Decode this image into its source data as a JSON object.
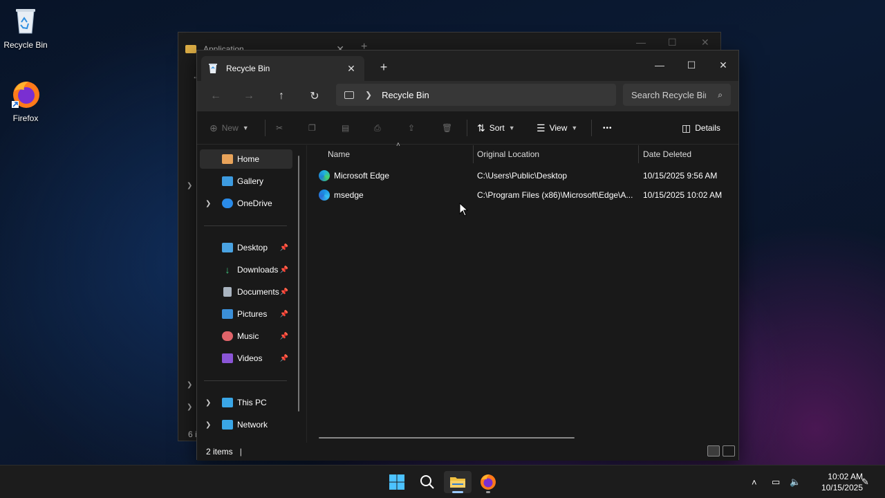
{
  "desktop": {
    "icons": [
      {
        "label": "Recycle Bin"
      },
      {
        "label": "Firefox"
      }
    ]
  },
  "background_window": {
    "tab_title": "Application",
    "status_text": "6 i"
  },
  "window": {
    "tab_title": "Recycle Bin",
    "address": {
      "crumb": "Recycle Bin",
      "search_placeholder": "Search Recycle Bin"
    },
    "toolbar": {
      "new_label": "New",
      "sort_label": "Sort",
      "view_label": "View",
      "more_label": "•••",
      "details_label": "Details"
    },
    "nav": {
      "top": [
        {
          "label": "Home"
        },
        {
          "label": "Gallery"
        },
        {
          "label": "OneDrive"
        }
      ],
      "quick": [
        {
          "label": "Desktop"
        },
        {
          "label": "Downloads"
        },
        {
          "label": "Documents"
        },
        {
          "label": "Pictures"
        },
        {
          "label": "Music"
        },
        {
          "label": "Videos"
        }
      ],
      "bottom": [
        {
          "label": "This PC"
        },
        {
          "label": "Network"
        }
      ]
    },
    "columns": {
      "name": "Name",
      "location": "Original Location",
      "date": "Date Deleted"
    },
    "rows": [
      {
        "name": "Microsoft Edge",
        "location": "C:\\Users\\Public\\Desktop",
        "date": "10/15/2025 9:56 AM"
      },
      {
        "name": "msedge",
        "location": "C:\\Program Files (x86)\\Microsoft\\Edge\\A...",
        "date": "10/15/2025 10:02 AM"
      }
    ],
    "status": {
      "item_count": "2 items"
    }
  },
  "taskbar": {
    "clock": {
      "time": "10:02 AM",
      "date": "10/15/2025"
    }
  },
  "colors": {
    "accent": "#0078d4",
    "folder": "#e0b046",
    "window_bg": "#191919"
  }
}
